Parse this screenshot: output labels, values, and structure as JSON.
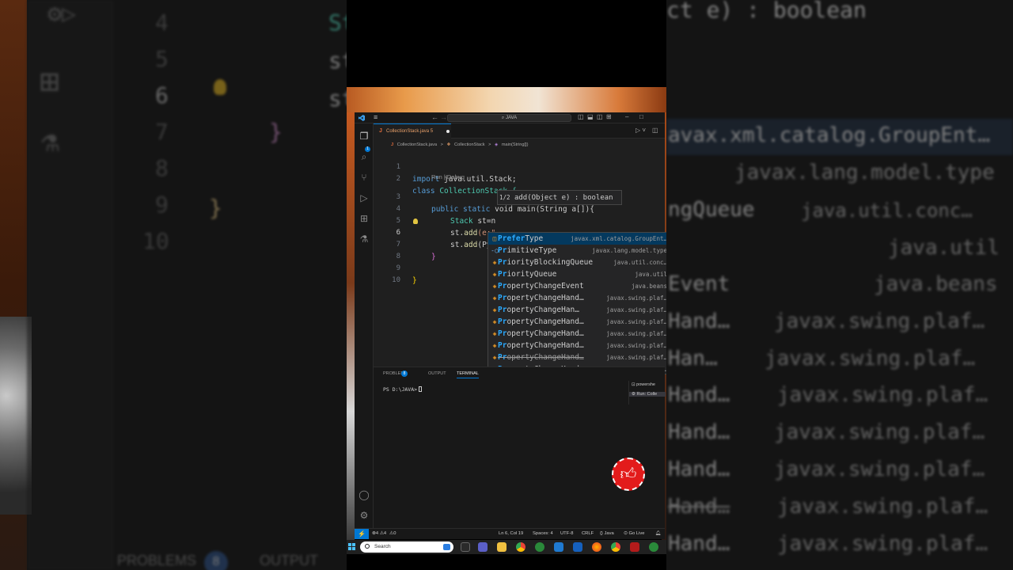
{
  "left_bg": {
    "line_numbers": [
      "4",
      "5",
      "6",
      "7",
      "8",
      "9",
      "10"
    ],
    "code_bits": [
      "St",
      "st",
      "st",
      "}",
      "}"
    ],
    "problems_label": "PROBLEMS",
    "problems_count": "8",
    "output_label": "OUTPUT"
  },
  "right_bg": {
    "signature": "ct e) : boolean",
    "items": [
      {
        "name": "",
        "detail": "avax.xml.catalog.GroupEnt…"
      },
      {
        "name": "",
        "detail": "javax.lang.model.type"
      },
      {
        "name": "ngQueue",
        "detail": "java.util.conc…"
      },
      {
        "name": "",
        "detail": "java.util"
      },
      {
        "name": "Event",
        "detail": "java.beans"
      },
      {
        "name": "Hand…",
        "detail": "javax.swing.plaf…"
      },
      {
        "name": "Han…",
        "detail": "javax.swing.plaf…"
      },
      {
        "name": "Hand…",
        "detail": "javax.swing.plaf…"
      },
      {
        "name": "Hand…",
        "detail": "javax.swing.plaf…"
      },
      {
        "name": "Hand…",
        "detail": "javax.swing.plaf…"
      },
      {
        "name": "Hand…",
        "detail": "javax.swing.plaf…"
      },
      {
        "name": "Hand…",
        "detail": "javax.swing.plaf…"
      }
    ]
  },
  "titlebar": {
    "search_text": "JAVA",
    "menu_icon": "hamburger-icon"
  },
  "tab": {
    "icon_letter": "J",
    "label": "CollectionStack.java 5"
  },
  "breadcrumb": {
    "file": "CollectionStack.java",
    "sep": ">",
    "class": "CollectionStack",
    "method": "main(String[])"
  },
  "editor": {
    "line_numbers": [
      "1",
      "2",
      "3",
      "4",
      "5",
      "6",
      "7",
      "8",
      "9",
      "10"
    ],
    "codelens": "Run | Debug",
    "line1": {
      "kw": "import",
      "rest": " java.util.Stack;"
    },
    "line2": {
      "kw": "class",
      "rest": " CollectionStack {"
    },
    "line3": {
      "kw1": "public",
      "kw2": " static",
      "rest": " void main(String a[]){"
    },
    "line4": {
      "type": "Stack",
      "rest": " st=n"
    },
    "line5": {
      "obj": "st.",
      "fn": "add",
      "rest": "(e:\""
    },
    "line6": {
      "obj": "st.",
      "fn": "add",
      "rest": "(Pyt)"
    },
    "line7": "}",
    "line9": "}"
  },
  "signature_help": {
    "counter": "1/2",
    "text": " add(Object e) : boolean"
  },
  "suggestions": [
    {
      "pre": "",
      "hl": "Prefer",
      "post": "Type",
      "detail": "javax.xml.catalog.GroupEnt…",
      "icon": "enum-icon",
      "selected": true,
      "deprecated": false
    },
    {
      "pre": "",
      "hl": "Pr",
      "post": "imitiveType",
      "detail": "javax.lang.model.type",
      "icon": "interface-icon",
      "selected": false,
      "deprecated": false
    },
    {
      "pre": "",
      "hl": "Pr",
      "post": "iorityBlockingQueue",
      "detail": "java.util.conc…",
      "icon": "class-icon",
      "selected": false,
      "deprecated": false
    },
    {
      "pre": "",
      "hl": "Pr",
      "post": "iorityQueue",
      "detail": "java.util",
      "icon": "class-icon",
      "selected": false,
      "deprecated": false
    },
    {
      "pre": "",
      "hl": "Pr",
      "post": "opertyChangeEvent",
      "detail": "java.beans",
      "icon": "class-icon",
      "selected": false,
      "deprecated": false
    },
    {
      "pre": "",
      "hl": "Pr",
      "post": "opertyChangeHand…",
      "detail": "javax.swing.plaf…",
      "icon": "class-icon",
      "selected": false,
      "deprecated": false
    },
    {
      "pre": "",
      "hl": "Pr",
      "post": "opertyChangeHan…",
      "detail": "javax.swing.plaf…",
      "icon": "class-icon",
      "selected": false,
      "deprecated": false
    },
    {
      "pre": "",
      "hl": "Pr",
      "post": "opertyChangeHand…",
      "detail": "javax.swing.plaf…",
      "icon": "class-icon",
      "selected": false,
      "deprecated": false
    },
    {
      "pre": "",
      "hl": "Pr",
      "post": "opertyChangeHand…",
      "detail": "javax.swing.plaf…",
      "icon": "class-icon",
      "selected": false,
      "deprecated": false
    },
    {
      "pre": "",
      "hl": "Pr",
      "post": "opertyChangeHand…",
      "detail": "javax.swing.plaf…",
      "icon": "class-icon",
      "selected": false,
      "deprecated": false
    },
    {
      "pre": "",
      "hl": "Pr",
      "post": "opertyChangeHand…",
      "detail": "javax.swing.plaf…",
      "icon": "class-icon",
      "selected": false,
      "deprecated": true
    },
    {
      "pre": "",
      "hl": "Pr",
      "post": "opertyChangeHand…",
      "detail": "javax.swing.plaf…",
      "icon": "class-icon",
      "selected": false,
      "deprecated": false
    }
  ],
  "panel": {
    "tabs": {
      "problems": "PROBLEMS",
      "problems_count": "8",
      "output": "OUTPUT",
      "terminal": "TERMINAL"
    },
    "prompt": "PS D:\\JAVA>",
    "terminals": [
      "powershe",
      "Run: Colle"
    ]
  },
  "statusbar": {
    "errors": "4",
    "warnings": "4",
    "position": "Ln 6, Col 19",
    "spaces": "Spaces: 4",
    "encoding": "UTF-8",
    "eol": "CRLF",
    "language": "Java",
    "golive": "Go Live"
  },
  "taskbar": {
    "search_placeholder": "Search"
  },
  "colors": {
    "accent": "#0078d4",
    "editor_bg": "#1f1f1f",
    "like_button": "#e31b1b",
    "match_highlight": "#2aaaff"
  }
}
